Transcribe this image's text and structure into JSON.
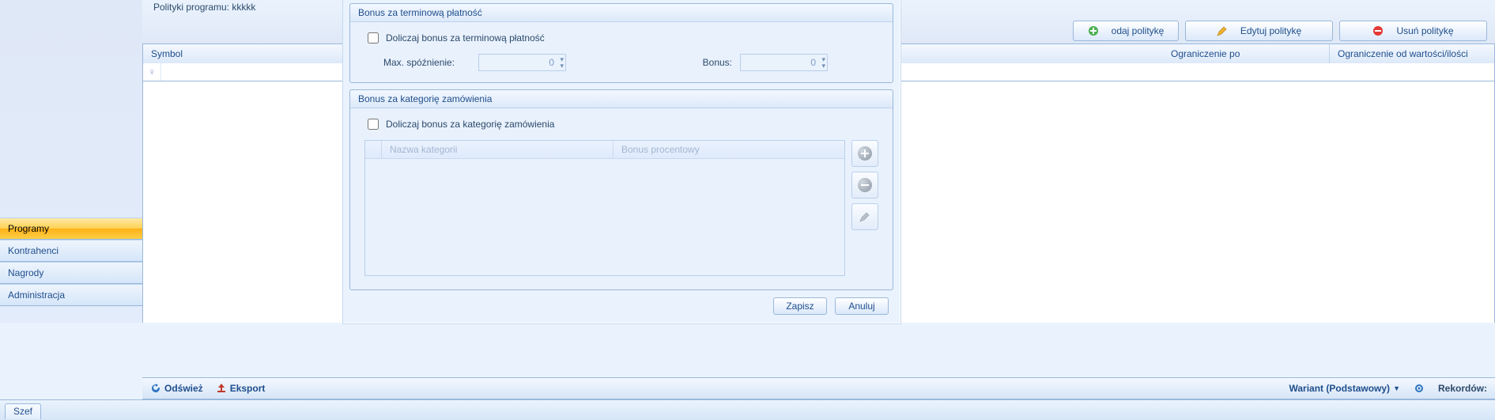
{
  "banner": {
    "title": "Polityki programu: kkkkk"
  },
  "buttons": {
    "add": "odaj politykę",
    "edit": "Edytuj politykę",
    "del": "Usuń politykę"
  },
  "grid": {
    "col_symbol": "Symbol",
    "col_limit_by": "Ograniczenie po",
    "col_limit_from": "Ograniczenie od wartości/ilości"
  },
  "sidebar": {
    "programy": "Programy",
    "kontrahenci": "Kontrahenci",
    "nagrody": "Nagrody",
    "administracja": "Administracja"
  },
  "bottom": {
    "refresh": "Odśwież",
    "export": "Eksport",
    "variant": "Wariant (Podstawowy)",
    "records": "Rekordów:"
  },
  "status": {
    "tab": "Szef"
  },
  "dialog": {
    "panel1_title": "Bonus za terminową płatność",
    "chk1": "Doliczaj bonus za terminową płatność",
    "max_delay_label": "Max. spóźnienie:",
    "max_delay_value": "0",
    "bonus_label": "Bonus:",
    "bonus_value": "0",
    "panel2_title": "Bonus za kategorię zamówienia",
    "chk2": "Doliczaj bonus za kategorię zamówienia",
    "cat_col1": "Nazwa kategorii",
    "cat_col2": "Bonus procentowy",
    "save": "Zapisz",
    "cancel": "Anuluj"
  },
  "icons": {
    "add": "plus-icon",
    "edit": "pencil-icon",
    "del": "minus-red-icon",
    "refresh": "refresh-icon",
    "export": "export-icon",
    "gear": "gear-icon",
    "dropdown": "chevron-down-icon"
  }
}
